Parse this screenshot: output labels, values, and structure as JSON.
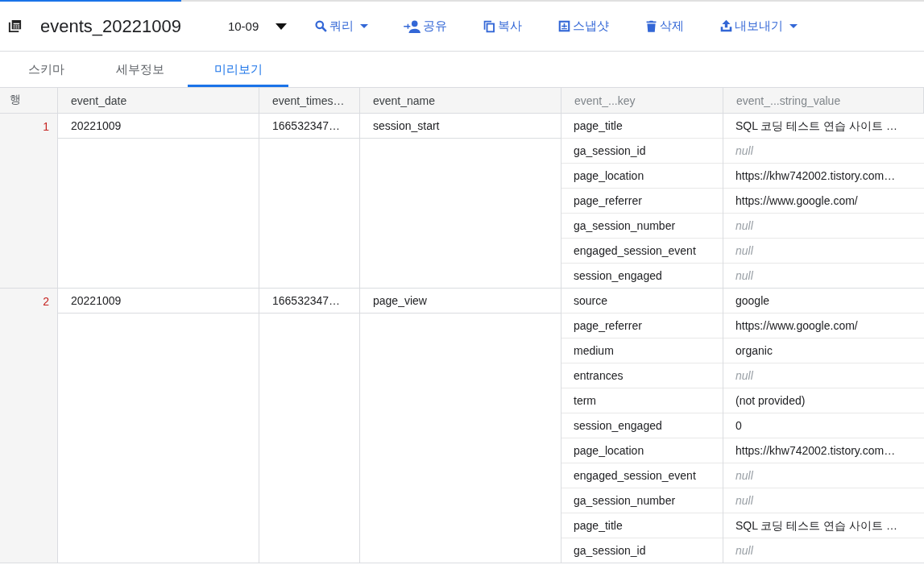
{
  "header": {
    "title": "events_20221009",
    "partition": "10-09",
    "actions": [
      {
        "kind": "query",
        "label": "쿼리",
        "dropdown": true
      },
      {
        "kind": "share",
        "label": "공유",
        "dropdown": false
      },
      {
        "kind": "copy",
        "label": "복사",
        "dropdown": false
      },
      {
        "kind": "snapshot",
        "label": "스냅샷",
        "dropdown": false
      },
      {
        "kind": "delete",
        "label": "삭제",
        "dropdown": false
      },
      {
        "kind": "export",
        "label": "내보내기",
        "dropdown": true
      }
    ]
  },
  "tabs": [
    {
      "label": "스키마",
      "selected": false
    },
    {
      "label": "세부정보",
      "selected": false
    },
    {
      "label": "미리보기",
      "selected": true
    }
  ],
  "table": {
    "columns": [
      {
        "label": "행",
        "nested": false
      },
      {
        "label": "event_date",
        "nested": false
      },
      {
        "label": "event_times…",
        "nested": false
      },
      {
        "label": "event_name",
        "nested": false
      },
      {
        "label": "event_...key",
        "nested": true
      },
      {
        "label": "event_...string_value",
        "nested": true
      }
    ],
    "rows": [
      {
        "row": "1",
        "event_date": "20221009",
        "event_timestamp": "166532347…",
        "event_name": "session_start",
        "params": [
          {
            "key": "page_title",
            "value": "SQL 코딩 테스트 연습 사이트 …",
            "is_null": false
          },
          {
            "key": "ga_session_id",
            "value": "null",
            "is_null": true
          },
          {
            "key": "page_location",
            "value": "https://khw742002.tistory.com…",
            "is_null": false
          },
          {
            "key": "page_referrer",
            "value": "https://www.google.com/",
            "is_null": false
          },
          {
            "key": "ga_session_number",
            "value": "null",
            "is_null": true
          },
          {
            "key": "engaged_session_event",
            "value": "null",
            "is_null": true
          },
          {
            "key": "session_engaged",
            "value": "null",
            "is_null": true
          }
        ]
      },
      {
        "row": "2",
        "event_date": "20221009",
        "event_timestamp": "166532347…",
        "event_name": "page_view",
        "params": [
          {
            "key": "source",
            "value": "google",
            "is_null": false
          },
          {
            "key": "page_referrer",
            "value": "https://www.google.com/",
            "is_null": false
          },
          {
            "key": "medium",
            "value": "organic",
            "is_null": false
          },
          {
            "key": "entrances",
            "value": "null",
            "is_null": true
          },
          {
            "key": "term",
            "value": "(not provided)",
            "is_null": false
          },
          {
            "key": "session_engaged",
            "value": "0",
            "is_null": false
          },
          {
            "key": "page_location",
            "value": "https://khw742002.tistory.com…",
            "is_null": false
          },
          {
            "key": "engaged_session_event",
            "value": "null",
            "is_null": true
          },
          {
            "key": "ga_session_number",
            "value": "null",
            "is_null": true
          },
          {
            "key": "page_title",
            "value": "SQL 코딩 테스트 연습 사이트 …",
            "is_null": false
          },
          {
            "key": "ga_session_id",
            "value": "null",
            "is_null": true
          }
        ]
      }
    ]
  }
}
